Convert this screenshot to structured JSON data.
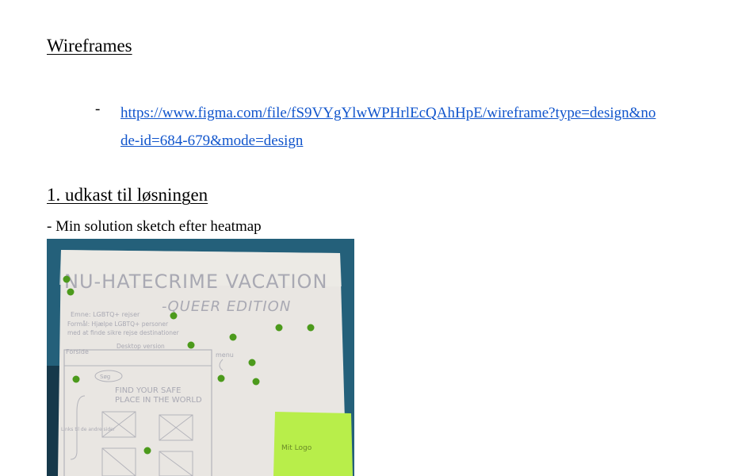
{
  "section_wireframes": {
    "heading": "Wireframes",
    "link_line_1": "https://www.figma.com/file/fS9VYgYlwWPHrlEcQAhHpE/wireframe?type=design&no",
    "link_line_2": "de-id=684-679&mode=design",
    "bullet": "-"
  },
  "section_draft": {
    "heading": "1. udkast til løsningen",
    "subtitle": "- Min solution sketch efter heatmap"
  },
  "sketch": {
    "title": "NU-HATECRIME VACATION",
    "subtitle": "-QUEER EDITION",
    "note_1": "Emne: LGBTQ+ rejser",
    "note_2": "Formål: Hjælpe LGBTQ+ personer",
    "note_3": "med at finde sikre rejse destinationer",
    "desktop_label": "Desktop version",
    "forside_label": "Forside",
    "menu_label": "menu",
    "search_label": "Søg",
    "headline_1": "FIND YOUR SAFE",
    "headline_2": "PLACE IN THE WORLD",
    "side_label": "Links til de andre sider",
    "sticky_note_text": "Mit Logo",
    "dot_color": "#4c9a1c",
    "sticky_color": "#b8ee4a"
  }
}
